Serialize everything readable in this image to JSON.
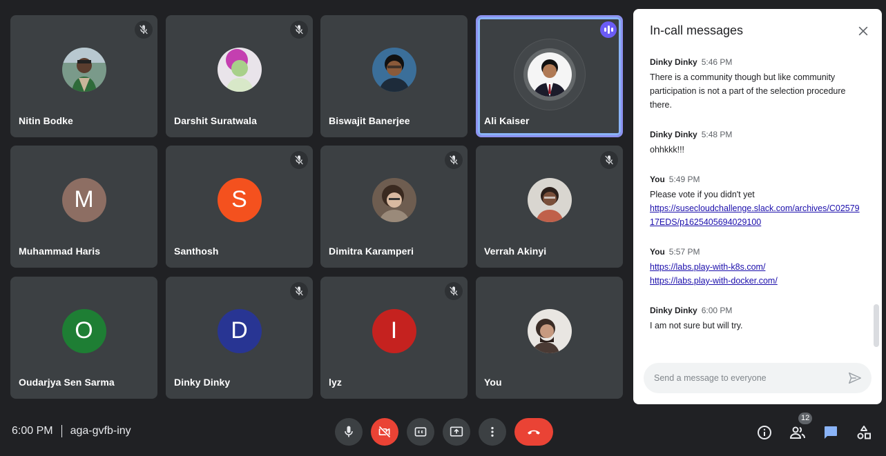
{
  "participants": [
    {
      "name": "Nitin Bodke",
      "muted": true,
      "avatar_type": "photo",
      "avatar_color": "#6d8c6a"
    },
    {
      "name": "Darshit Suratwala",
      "muted": true,
      "avatar_type": "photo",
      "avatar_color": "#c58ac4"
    },
    {
      "name": "Biswajit Banerjee",
      "muted": false,
      "avatar_type": "photo",
      "avatar_color": "#2a3b52"
    },
    {
      "name": "Ali Kaiser",
      "muted": false,
      "speaking": true,
      "avatar_type": "photo",
      "avatar_color": "#ffffff"
    },
    {
      "name": "Muhammad Haris",
      "muted": false,
      "avatar_type": "letter",
      "letter": "M",
      "avatar_color": "#8d6e63"
    },
    {
      "name": "Santhosh",
      "muted": true,
      "avatar_type": "letter",
      "letter": "S",
      "avatar_color": "#f4511e"
    },
    {
      "name": "Dimitra Karamperi",
      "muted": true,
      "avatar_type": "photo",
      "avatar_color": "#6b5a4e"
    },
    {
      "name": "Verrah Akinyi",
      "muted": true,
      "avatar_type": "photo",
      "avatar_color": "#b08070"
    },
    {
      "name": "Oudarjya Sen Sarma",
      "muted": false,
      "avatar_type": "letter",
      "letter": "O",
      "avatar_color": "#1e7e34"
    },
    {
      "name": "Dinky Dinky",
      "muted": true,
      "avatar_type": "letter",
      "letter": "D",
      "avatar_color": "#283593"
    },
    {
      "name": "lyz",
      "muted": true,
      "avatar_type": "letter",
      "letter": "I",
      "avatar_color": "#c5221f"
    },
    {
      "name": "You",
      "muted": false,
      "avatar_type": "photo",
      "avatar_color": "#5a4a42"
    }
  ],
  "chat": {
    "title": "In-call messages",
    "messages": [
      {
        "sender": "Dinky Dinky",
        "time": "5:46 PM",
        "lines": [
          "There is a community though but like community participation is not a part of the selection procedure there."
        ],
        "links": []
      },
      {
        "sender": "Dinky Dinky",
        "time": "5:48 PM",
        "lines": [
          "ohhkkk!!!"
        ],
        "links": []
      },
      {
        "sender": "You",
        "time": "5:49 PM",
        "lines": [
          "Please vote if you didn't yet"
        ],
        "links": [
          "https://susecloudchallenge.slack.com/archives/C0257917EDS/p1625405694029100"
        ]
      },
      {
        "sender": "You",
        "time": "5:57 PM",
        "lines": [],
        "links": [
          "https://labs.play-with-k8s.com/",
          "https://labs.play-with-docker.com/"
        ]
      },
      {
        "sender": "Dinky Dinky",
        "time": "6:00 PM",
        "lines": [
          "I am not sure but will try."
        ],
        "links": []
      }
    ],
    "input_placeholder": "Send a message to everyone",
    "input_value": ""
  },
  "bottom_bar": {
    "time": "6:00 PM",
    "meeting_code": "aga-gvfb-iny",
    "participant_count": "12"
  },
  "colors": {
    "background": "#202124",
    "tile": "#3c4043",
    "speaking_border": "#8c92f0",
    "end_call": "#ea4335",
    "chat_active": "#8ab4f8"
  }
}
